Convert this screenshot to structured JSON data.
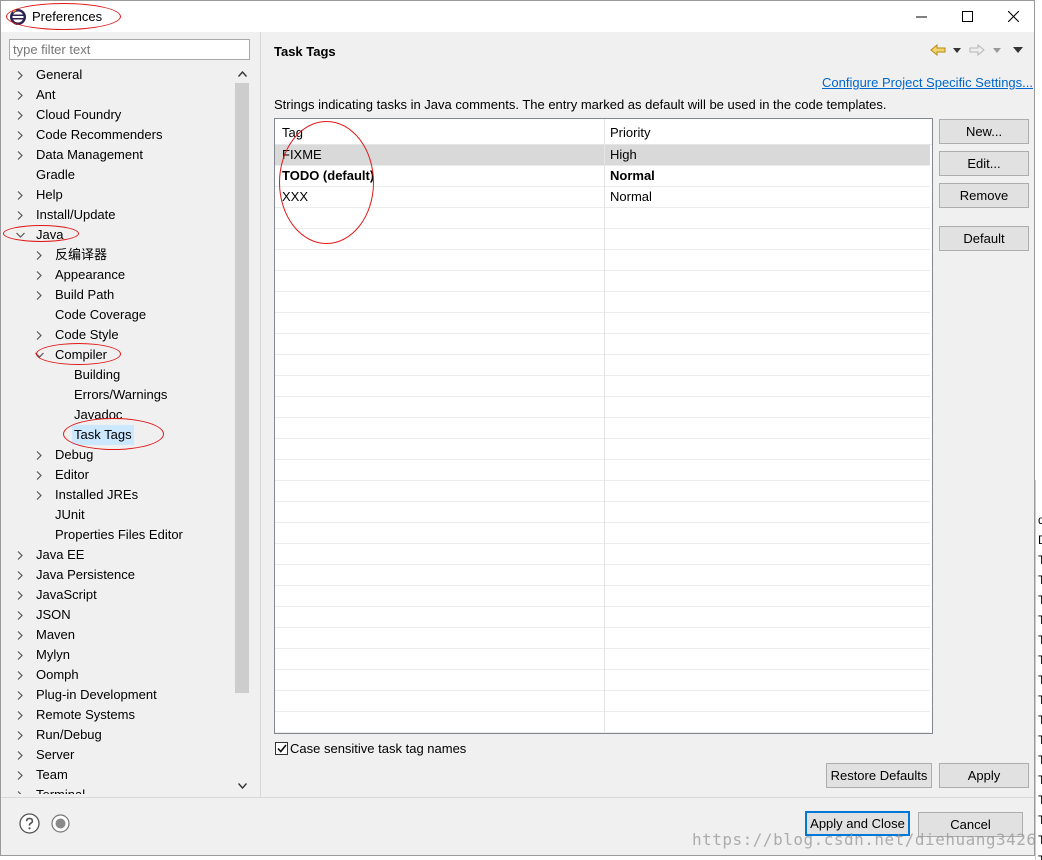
{
  "window": {
    "title": "Preferences",
    "controls": [
      "minimize",
      "maximize",
      "close"
    ]
  },
  "filter": {
    "placeholder": "type filter text",
    "value": ""
  },
  "tree": {
    "items": [
      {
        "label": "General",
        "level": 0,
        "expander": "collapsed"
      },
      {
        "label": "Ant",
        "level": 0,
        "expander": "collapsed"
      },
      {
        "label": "Cloud Foundry",
        "level": 0,
        "expander": "collapsed"
      },
      {
        "label": "Code Recommenders",
        "level": 0,
        "expander": "collapsed"
      },
      {
        "label": "Data Management",
        "level": 0,
        "expander": "collapsed"
      },
      {
        "label": "Gradle",
        "level": 0,
        "expander": "none"
      },
      {
        "label": "Help",
        "level": 0,
        "expander": "collapsed"
      },
      {
        "label": "Install/Update",
        "level": 0,
        "expander": "collapsed"
      },
      {
        "label": "Java",
        "level": 0,
        "expander": "expanded"
      },
      {
        "label": "反编译器",
        "level": 1,
        "expander": "collapsed"
      },
      {
        "label": "Appearance",
        "level": 1,
        "expander": "collapsed"
      },
      {
        "label": "Build Path",
        "level": 1,
        "expander": "collapsed"
      },
      {
        "label": "Code Coverage",
        "level": 1,
        "expander": "none"
      },
      {
        "label": "Code Style",
        "level": 1,
        "expander": "collapsed"
      },
      {
        "label": "Compiler",
        "level": 1,
        "expander": "expanded"
      },
      {
        "label": "Building",
        "level": 2,
        "expander": "none"
      },
      {
        "label": "Errors/Warnings",
        "level": 2,
        "expander": "none"
      },
      {
        "label": "Javadoc",
        "level": 2,
        "expander": "none"
      },
      {
        "label": "Task Tags",
        "level": 2,
        "expander": "none",
        "selected": true
      },
      {
        "label": "Debug",
        "level": 1,
        "expander": "collapsed"
      },
      {
        "label": "Editor",
        "level": 1,
        "expander": "collapsed"
      },
      {
        "label": "Installed JREs",
        "level": 1,
        "expander": "collapsed"
      },
      {
        "label": "JUnit",
        "level": 1,
        "expander": "none"
      },
      {
        "label": "Properties Files Editor",
        "level": 1,
        "expander": "none"
      },
      {
        "label": "Java EE",
        "level": 0,
        "expander": "collapsed"
      },
      {
        "label": "Java Persistence",
        "level": 0,
        "expander": "collapsed"
      },
      {
        "label": "JavaScript",
        "level": 0,
        "expander": "collapsed"
      },
      {
        "label": "JSON",
        "level": 0,
        "expander": "collapsed"
      },
      {
        "label": "Maven",
        "level": 0,
        "expander": "collapsed"
      },
      {
        "label": "Mylyn",
        "level": 0,
        "expander": "collapsed"
      },
      {
        "label": "Oomph",
        "level": 0,
        "expander": "collapsed"
      },
      {
        "label": "Plug-in Development",
        "level": 0,
        "expander": "collapsed"
      },
      {
        "label": "Remote Systems",
        "level": 0,
        "expander": "collapsed"
      },
      {
        "label": "Run/Debug",
        "level": 0,
        "expander": "collapsed"
      },
      {
        "label": "Server",
        "level": 0,
        "expander": "collapsed"
      },
      {
        "label": "Team",
        "level": 0,
        "expander": "collapsed"
      },
      {
        "label": "Terminal",
        "level": 0,
        "expander": "collapsed"
      }
    ]
  },
  "page": {
    "title": "Task Tags",
    "nav_icons": [
      "back-arrow-icon",
      "back-menu-icon",
      "forward-arrow-icon",
      "forward-menu-icon",
      "view-menu-icon"
    ],
    "configure_link": "Configure Project Specific Settings...",
    "description": "Strings indicating tasks in Java comments. The entry marked as default will be used in the code templates.",
    "table": {
      "columns": [
        "Tag",
        "Priority"
      ],
      "rows": [
        {
          "tag": "FIXME",
          "priority": "High",
          "selected": true
        },
        {
          "tag": "TODO (default)",
          "priority": "Normal",
          "bold": true
        },
        {
          "tag": "XXX",
          "priority": "Normal"
        }
      ]
    },
    "buttons": {
      "new": "New...",
      "edit": "Edit...",
      "remove": "Remove",
      "default": "Default"
    },
    "case_sensitive": {
      "label": "Case sensitive task tag names",
      "checked": true
    },
    "restore_defaults": "Restore Defaults",
    "apply": "Apply"
  },
  "footer": {
    "apply_and_close": "Apply and Close",
    "cancel": "Cancel",
    "icons": [
      "help-icon",
      "record-macro-icon"
    ]
  },
  "watermark": "https://blog.csdn.net/diehuang3426",
  "background_window_letters": [
    "d",
    "D",
    "T",
    "T",
    "T",
    "T",
    "T",
    "T",
    "T",
    "T",
    "T",
    "T",
    "T",
    "T",
    "T",
    "T",
    "T",
    "T"
  ],
  "colors": {
    "annotation": "#e01818",
    "link": "#0066cc",
    "selection": "#cce8ff",
    "focus": "#0078d7"
  }
}
